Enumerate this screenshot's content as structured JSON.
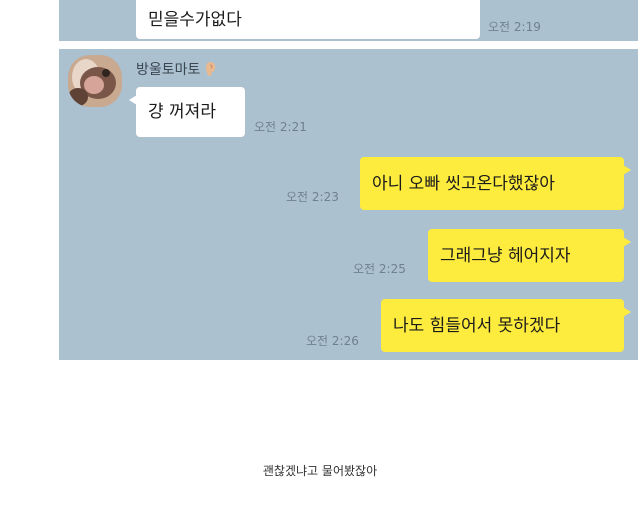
{
  "top_message": {
    "text": "믿을수가없다",
    "time": "오전 2:19"
  },
  "sender": {
    "name": "방울토마토",
    "badge_icon": "ear-emoji-icon"
  },
  "messages": [
    {
      "text": "걍 꺼져라",
      "time": "오전 2:21",
      "side": "left"
    },
    {
      "text": "아니 오빠 씻고온다했잖아",
      "time": "오전 2:23",
      "side": "right"
    },
    {
      "text": "그래그냥 헤어지자",
      "time": "오전 2:25",
      "side": "right"
    },
    {
      "text": "나도 힘들어서 못하겠다",
      "time": "오전 2:26",
      "side": "right"
    }
  ],
  "caption": "괜찮겠냐고 물어봤잖아",
  "colors": {
    "chat_background": "#abc1d0",
    "my_bubble": "#fdeb3d",
    "other_bubble": "#ffffff",
    "timestamp": "#6f8190"
  }
}
